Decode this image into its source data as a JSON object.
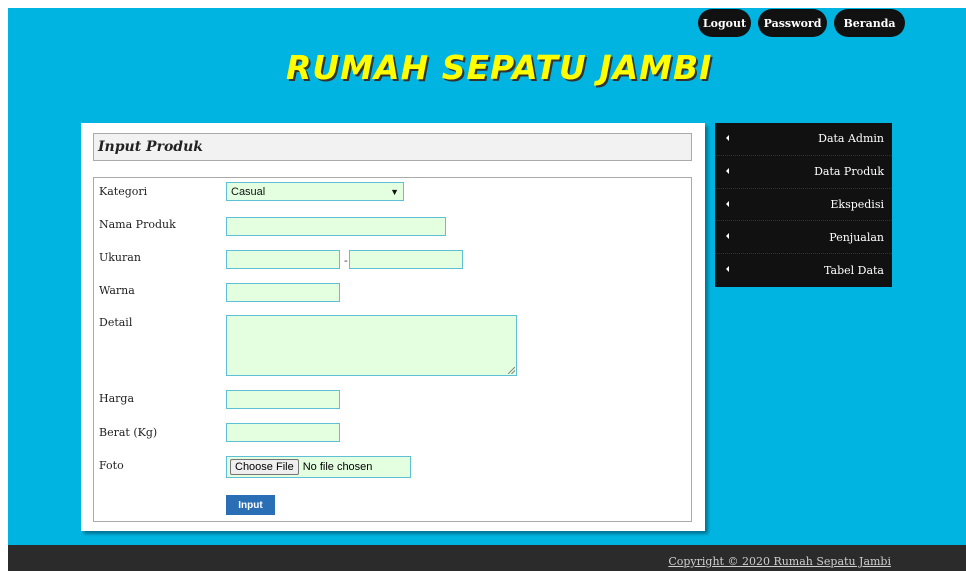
{
  "topnav": {
    "logout": "Logout",
    "password": "Password",
    "beranda": "Beranda"
  },
  "site": {
    "title": "RUMAH SEPATU JAMBI"
  },
  "panel": {
    "title": "Input Produk"
  },
  "form": {
    "kategori_label": "Kategori",
    "kategori_value": "Casual",
    "nama_label": "Nama Produk",
    "ukuran_label": "Ukuran",
    "ukuran_separator": "-",
    "warna_label": "Warna",
    "detail_label": "Detail",
    "harga_label": "Harga",
    "berat_label": "Berat (Kg)",
    "foto_label": "Foto",
    "file_button": "Choose File",
    "file_status": "No file chosen",
    "submit_label": "Input"
  },
  "sidebar": {
    "items": [
      {
        "label": "Data Admin"
      },
      {
        "label": "Data Produk"
      },
      {
        "label": "Ekspedisi"
      },
      {
        "label": "Penjualan"
      },
      {
        "label": "Tabel Data"
      }
    ]
  },
  "footer": {
    "copyright": "Copyright © 2020 Rumah Sepatu Jambi"
  },
  "colors": {
    "background": "#00b4e1",
    "title": "#ffff00",
    "input_bg": "#e3ffe0",
    "button": "#2a6fb6",
    "nav": "#111111"
  }
}
